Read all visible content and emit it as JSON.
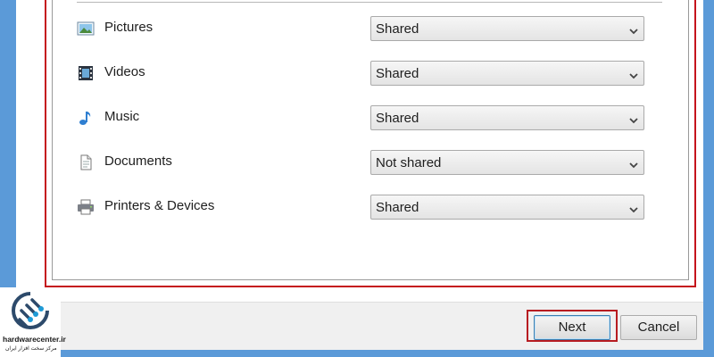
{
  "sharing": {
    "rows": [
      {
        "label": "Pictures",
        "icon": "pictures-icon",
        "value": "Shared"
      },
      {
        "label": "Videos",
        "icon": "videos-icon",
        "value": "Shared"
      },
      {
        "label": "Music",
        "icon": "music-icon",
        "value": "Shared"
      },
      {
        "label": "Documents",
        "icon": "documents-icon",
        "value": "Not shared"
      },
      {
        "label": "Printers & Devices",
        "icon": "printer-icon",
        "value": "Shared"
      }
    ]
  },
  "buttons": {
    "next": "Next",
    "cancel": "Cancel"
  },
  "watermark": {
    "name": "hardwarecenter.ir",
    "subtitle": "مرکز سخت افزار ایران"
  },
  "colors": {
    "frame": "#5b9ad8",
    "highlight": "#c5141c",
    "dialog_bg": "#f0f0f0"
  }
}
